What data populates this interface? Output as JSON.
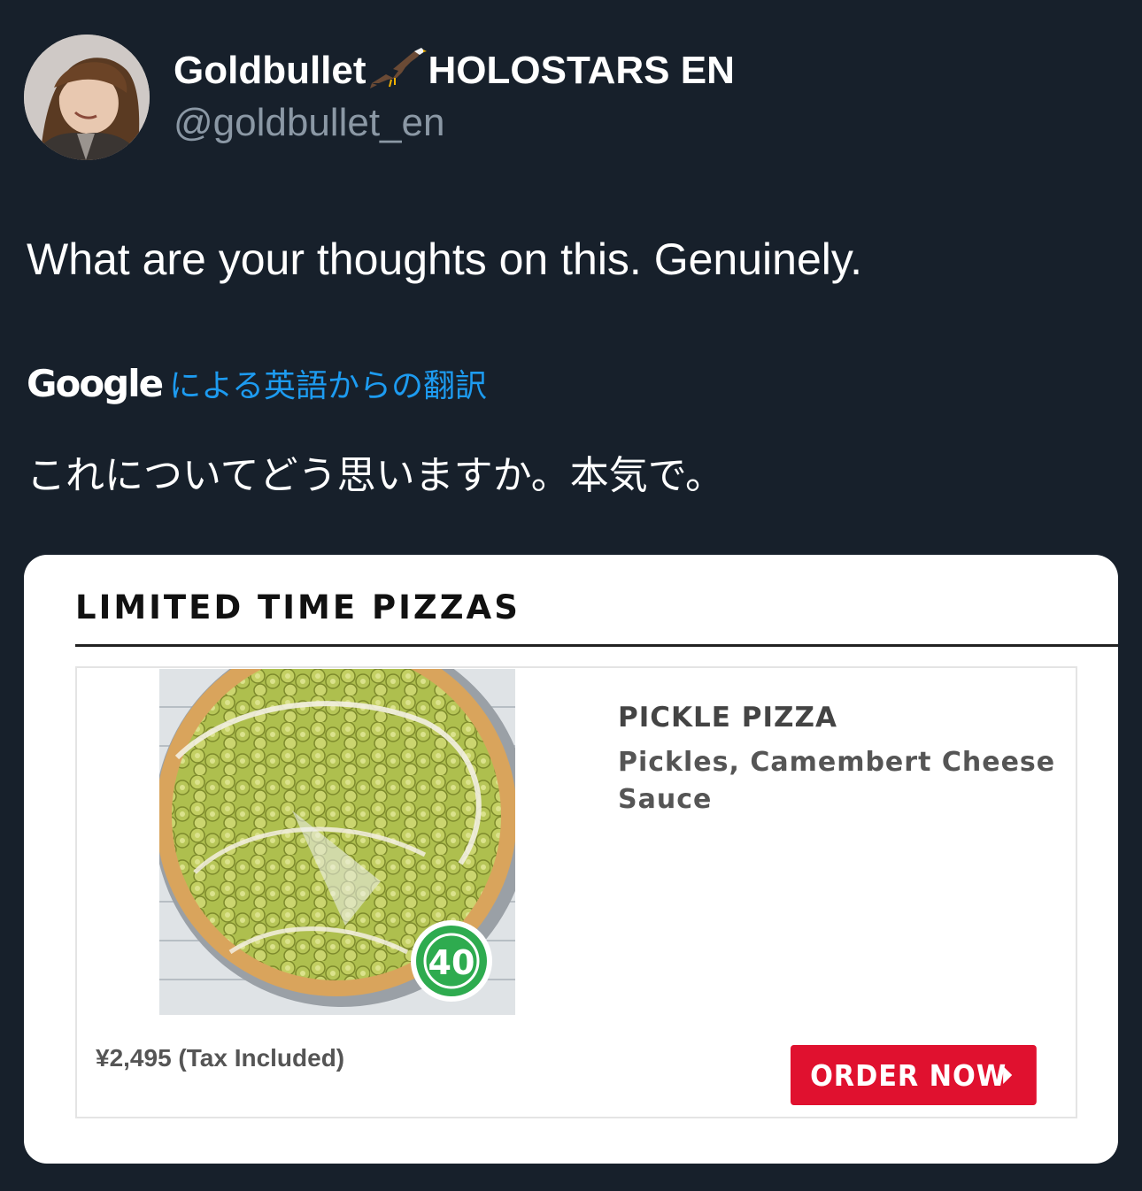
{
  "tweet": {
    "display_name": "Goldbullet",
    "display_name_suffix": "HOLOSTARS EN",
    "handle": "@goldbullet_en",
    "text": "What are your thoughts on this. Genuinely.",
    "translation_provider": "Google",
    "translation_label": "による英語からの翻訳",
    "translated_text": "これについてどう思いますか。本気で。"
  },
  "card": {
    "heading": "LIMITED TIME PIZZAS",
    "product_name": "PICKLE PIZZA",
    "product_description": "Pickles, Camembert Cheese Sauce",
    "price": "¥2,495 (Tax Included)",
    "order_button_label": "ORDER NOW",
    "badge_value": "40"
  },
  "icons": {
    "name_emoji": "eagle-icon",
    "order_arrow": "chevron-right-icon"
  },
  "colors": {
    "background": "#17202b",
    "link": "#1d9bf0",
    "handle": "#8b98a5",
    "order_button": "#e0112f",
    "badge": "#2eab4f"
  }
}
